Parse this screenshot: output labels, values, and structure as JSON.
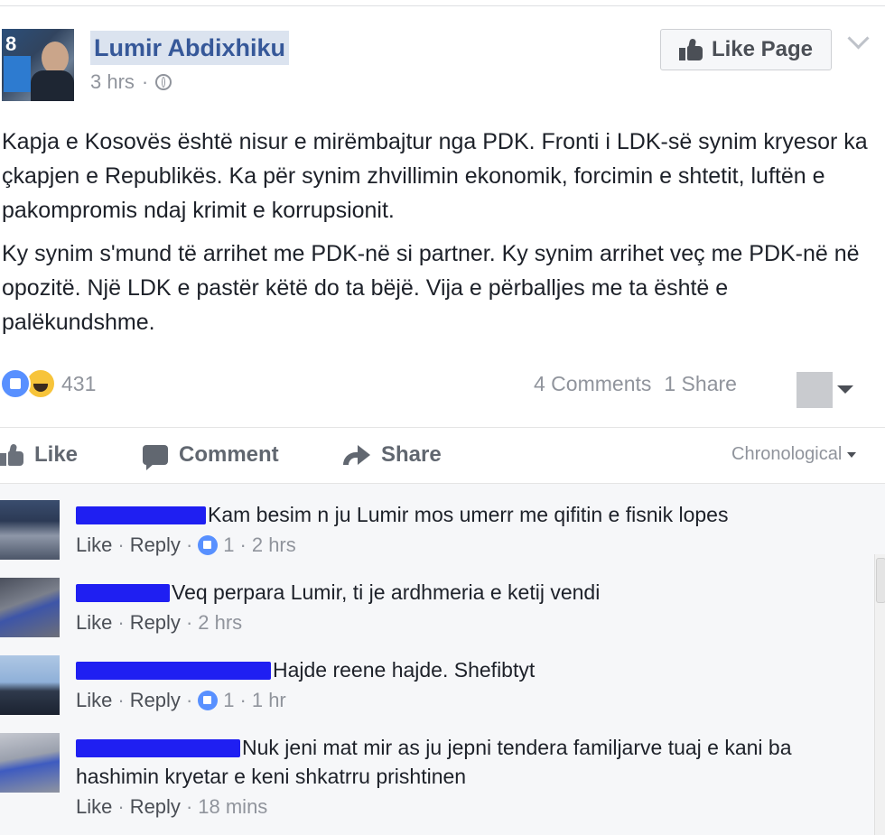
{
  "post": {
    "author": "Lumir Abdixhiku",
    "avatar_badge": "8",
    "time": "3 hrs",
    "separator": "·",
    "like_page_label": "Like Page",
    "paragraphs": [
      "Kapja e Kosovës është nisur e mirëmbajtur nga PDK. Fronti i LDK-së synim kryesor ka çkapjen e Republikës. Ka për synim zhvillimin ekonomik, forcimin e shtetit, luftën e pakompromis ndaj krimit e korrupsionit.",
      "Ky synim s'mund të arrihet me PDK-në si partner. Ky synim arrihet veç me PDK-në në opozitë. Një LDK e pastër këtë do ta bëjë. Vija e përballjes me ta është e palëkundshme."
    ],
    "reaction_count": "431",
    "comments_count": "4 Comments",
    "shares_count": "1 Share"
  },
  "actions": {
    "like": "Like",
    "comment": "Comment",
    "share": "Share",
    "sort": "Chronological"
  },
  "comments": [
    {
      "text": "Kam besim n ju Lumir mos umerr me qifitin e fisnik lopes",
      "like": "Like",
      "reply": "Reply",
      "likes": "1",
      "time": "2 hrs"
    },
    {
      "text": "Veq perpara Lumir, ti je ardhmeria e ketij vendi",
      "like": "Like",
      "reply": "Reply",
      "likes": "",
      "time": "2 hrs"
    },
    {
      "text": "Hajde reene hajde. Shefibtyt",
      "like": "Like",
      "reply": "Reply",
      "likes": "1",
      "time": "1 hr"
    },
    {
      "text": "Nuk jeni mat mir as ju jepni tendera familjarve tuaj e kani ba",
      "text2": "hashimin kryetar e keni shkatrru prishtinen",
      "like": "Like",
      "reply": "Reply",
      "likes": "",
      "time": "18 mins"
    }
  ],
  "colors": {
    "link": "#365899",
    "redaction": "#1f1ff2",
    "reaction_like": "#5890ff",
    "reaction_haha": "#f7c43a"
  }
}
